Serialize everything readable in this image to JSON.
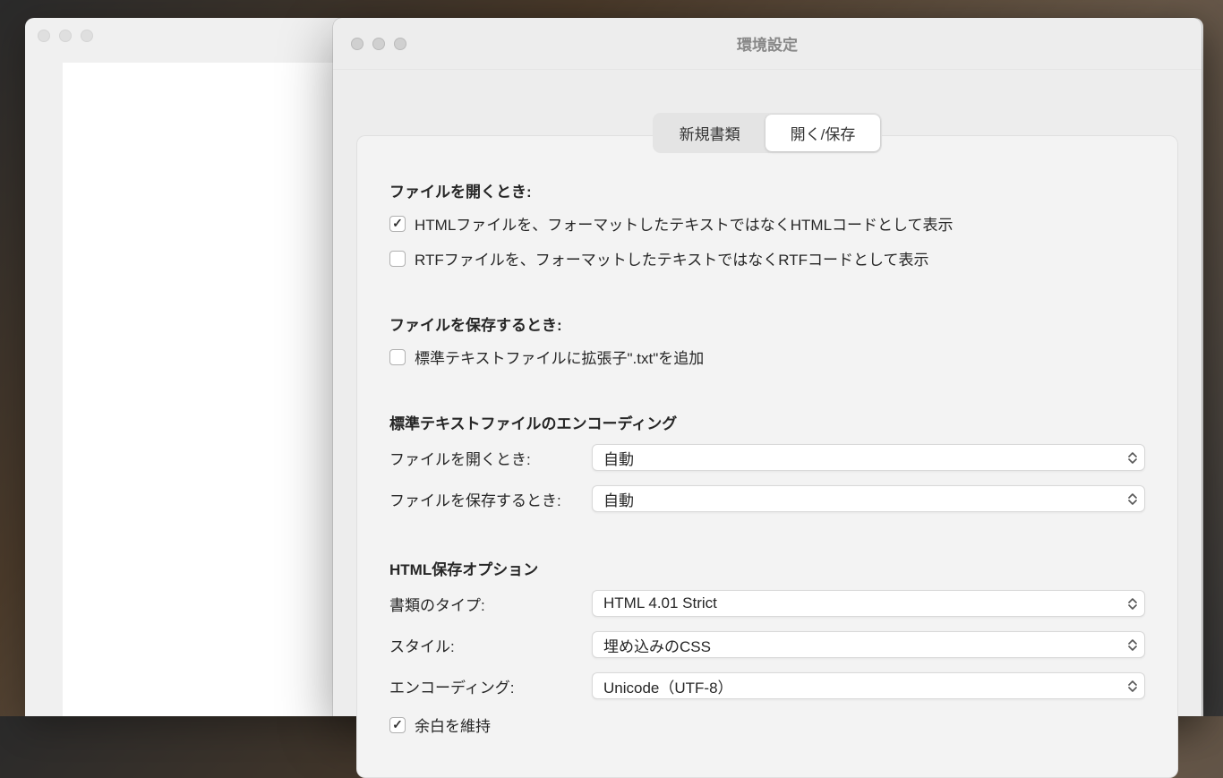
{
  "window": {
    "title": "環境設定"
  },
  "tabs": {
    "new_document": "新規書類",
    "open_save": "開く/保存"
  },
  "sections": {
    "open": {
      "title": "ファイルを開くとき:",
      "html_as_code": "HTMLファイルを、フォーマットしたテキストではなくHTMLコードとして表示",
      "rtf_as_code": "RTFファイルを、フォーマットしたテキストではなくRTFコードとして表示"
    },
    "save": {
      "title": "ファイルを保存するとき:",
      "add_txt": "標準テキストファイルに拡張子\".txt\"を追加"
    },
    "encoding": {
      "title": "標準テキストファイルのエンコーディング",
      "open_label": "ファイルを開くとき:",
      "open_value": "自動",
      "save_label": "ファイルを保存するとき:",
      "save_value": "自動"
    },
    "html_options": {
      "title": "HTML保存オプション",
      "doc_type_label": "書類のタイプ:",
      "doc_type_value": "HTML 4.01 Strict",
      "style_label": "スタイル:",
      "style_value": "埋め込みのCSS",
      "encoding_label": "エンコーディング:",
      "encoding_value": "Unicode（UTF-8）",
      "preserve_whitespace": "余白を維持"
    }
  }
}
